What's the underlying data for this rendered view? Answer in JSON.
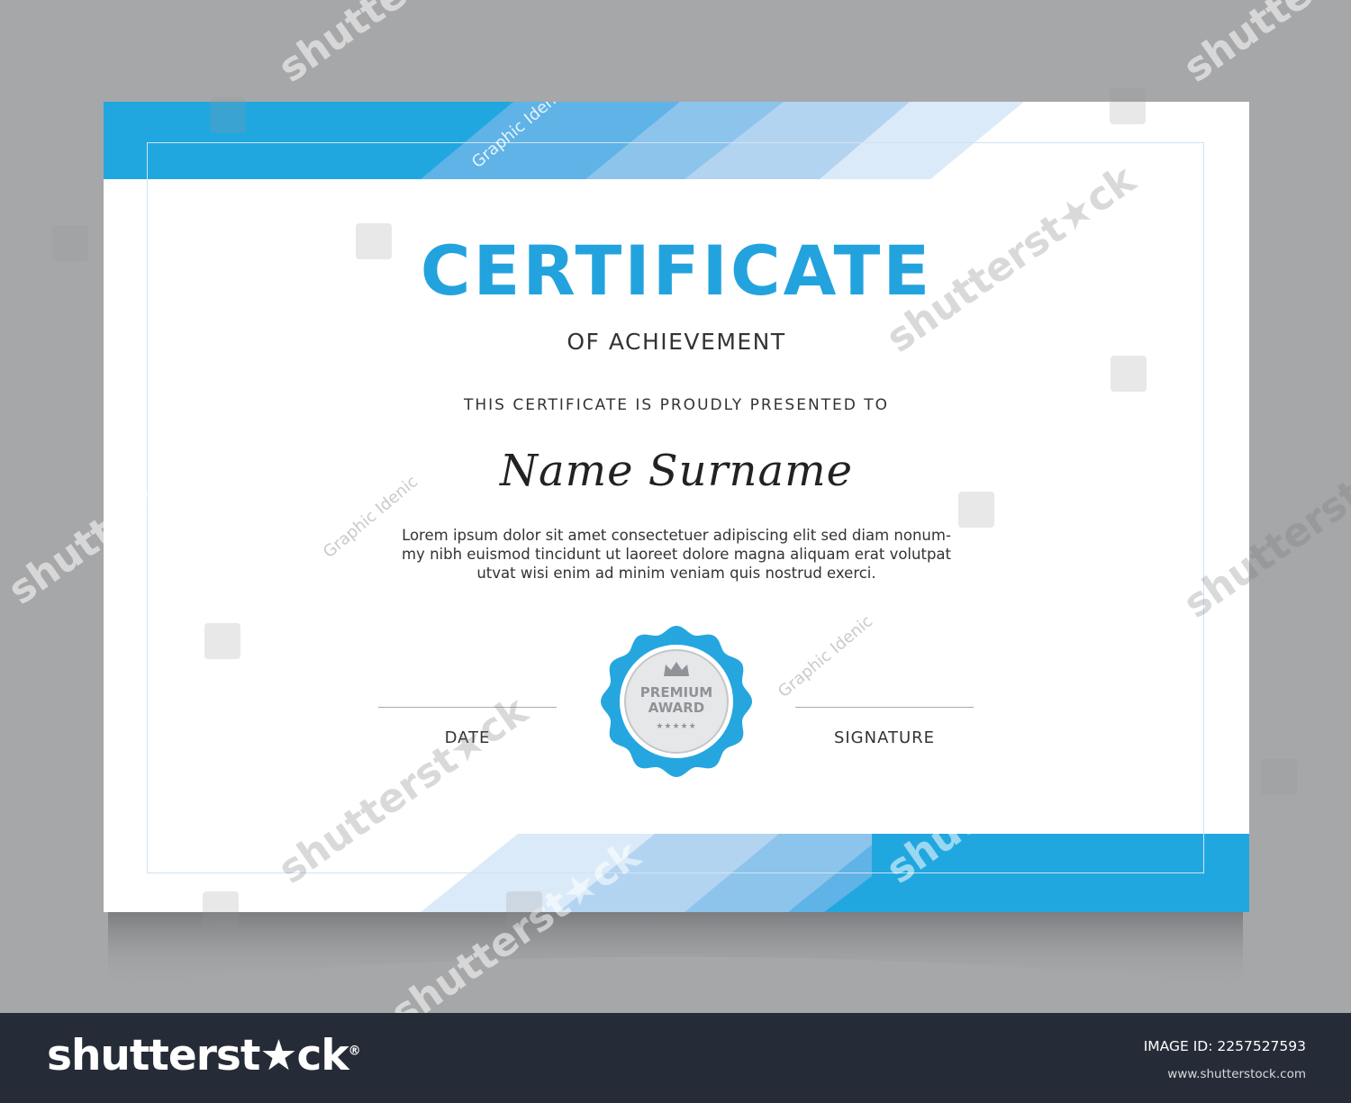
{
  "certificate": {
    "title": "CERTIFICATE",
    "subtitle": "OF ACHIEVEMENT",
    "presented_to": "THIS CERTIFICATE IS PROUDLY PRESENTED TO",
    "recipient_name": "Name Surname",
    "body_lines": [
      "Lorem ipsum dolor sit amet consectetuer adipiscing elit sed diam nonum-",
      "my nibh euismod tincidunt ut laoreet dolore magna aliquam erat volutpat",
      "utvat wisi enim ad minim veniam quis nostrud exerci."
    ],
    "date_label": "DATE",
    "signature_label": "SIGNATURE",
    "seal": {
      "line1": "PREMIUM",
      "line2": "AWARD",
      "stars": "★★★★★",
      "icon": "crown-icon"
    }
  },
  "watermarks": {
    "stock_text": "shutterst★ck",
    "author_text": "Graphic Idenic"
  },
  "footer": {
    "logo": "shutterst★ck",
    "logo_registered": "®",
    "image_id": "IMAGE ID: 2257527593",
    "url": "www.shutterstock.com"
  },
  "colors": {
    "accent": "#23a3dd",
    "band_light": "#cfe3f7",
    "band_mid": "#88c0ea",
    "background": "#a6a7a9",
    "footer": "#262c37"
  }
}
